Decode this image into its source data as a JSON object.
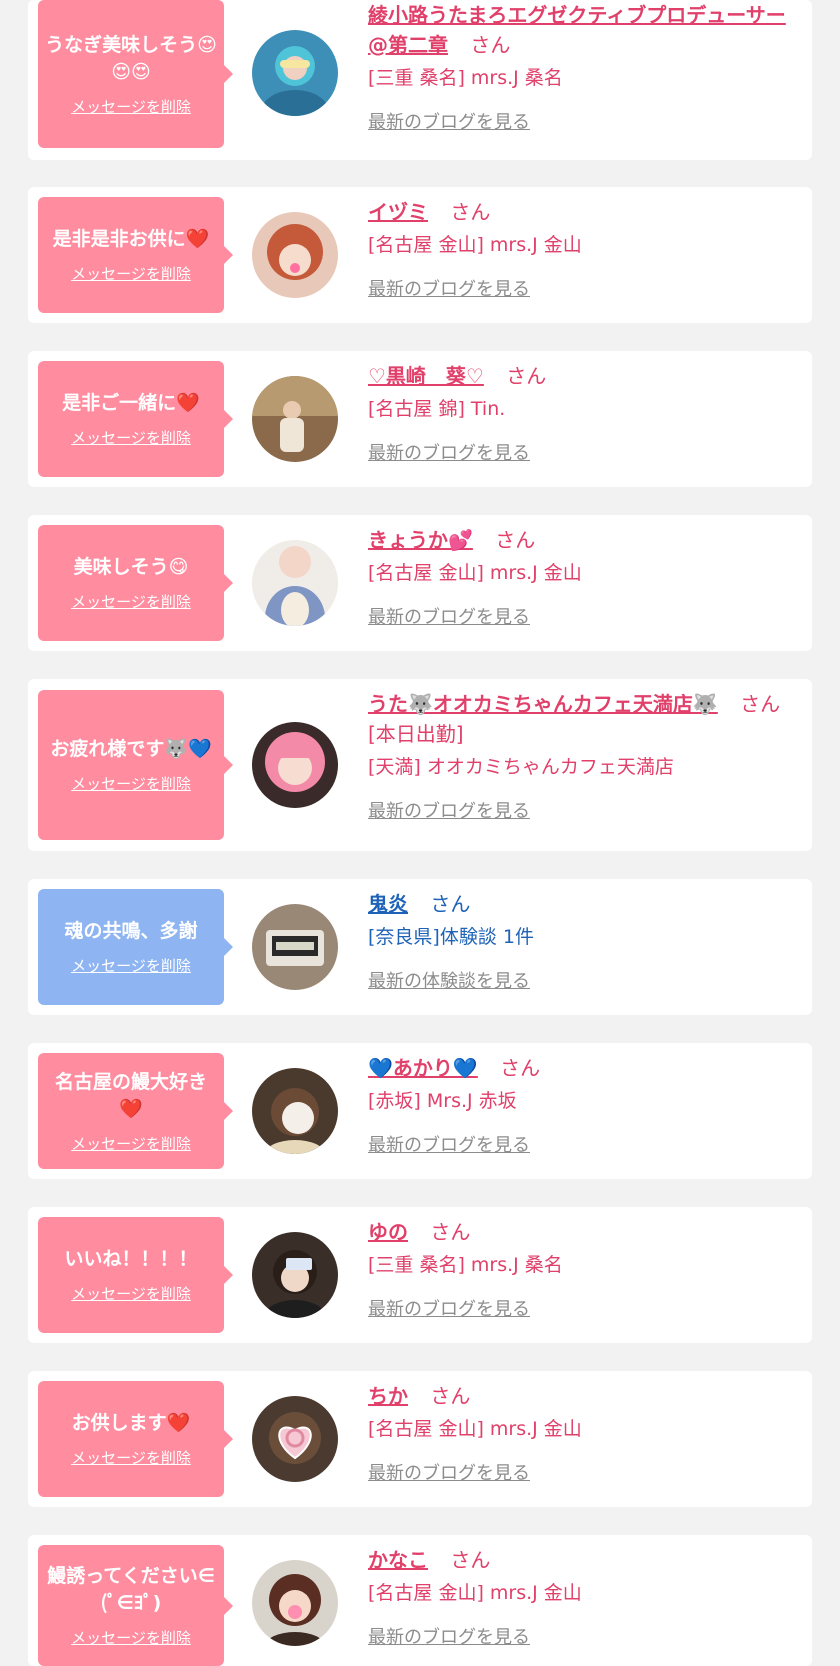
{
  "colors": {
    "pink_bubble": "#ff8c9f",
    "blue_bubble": "#8eb4f2",
    "pink_text": "#e0406a",
    "blue_text": "#1f63b8",
    "gray_link": "#8c8c8c",
    "background": "#f2f2f2"
  },
  "delete_label": "メッセージを削除",
  "san_label": "さん",
  "items": [
    {
      "message": "うなぎ美味しそう😍😍😍",
      "name": "綾小路うたまろエグゼクティブプロデューサー@第二章",
      "name_suffix": "",
      "shop": "[三重 桑名] mrs.J 桑名",
      "link": "最新のブログを見る",
      "avatar_icon": "girl-avatar-icon"
    },
    {
      "message": "是非是非お供に❤️",
      "name": "イヅミ",
      "name_suffix": "",
      "shop": "[名古屋 金山] mrs.J 金山",
      "link": "最新のブログを見る",
      "avatar_icon": "girl-avatar-icon"
    },
    {
      "message": "是非ご一緒に❤️",
      "name": "♡黒崎　葵♡",
      "name_suffix": "",
      "shop": "[名古屋 錦] Tin.",
      "link": "最新のブログを見る",
      "avatar_icon": "girl-avatar-icon"
    },
    {
      "message": "美味しそう😋",
      "name": "きょうか💕",
      "name_suffix": "",
      "shop": "[名古屋 金山] mrs.J 金山",
      "link": "最新のブログを見る",
      "avatar_icon": "girl-avatar-icon"
    },
    {
      "message": "お疲れ様です🐺💙",
      "name": "うた🐺オオカミちゃんカフェ天満店🐺",
      "name_suffix": "[本日出勤]",
      "shop": "[天満] オオカミちゃんカフェ天満店",
      "link": "最新のブログを見る",
      "avatar_icon": "girl-avatar-icon"
    },
    {
      "message": "魂の共鳴、多謝",
      "name": "鬼炎",
      "name_suffix": "",
      "shop": "[奈良県]体験談 1件",
      "link": "最新の体験談を見る",
      "avatar_icon": "clock-avatar-icon"
    },
    {
      "message": "名古屋の鰻大好き❤️",
      "name": "💙あかり💙",
      "name_suffix": "",
      "shop": "[赤坂] Mrs.J 赤坂",
      "link": "最新のブログを見る",
      "avatar_icon": "girl-avatar-icon"
    },
    {
      "message": "いいね！！！！",
      "name": "ゆの",
      "name_suffix": "",
      "shop": "[三重 桑名] mrs.J 桑名",
      "link": "最新のブログを見る",
      "avatar_icon": "girl-avatar-icon"
    },
    {
      "message": "お供します❤️",
      "name": "ちか",
      "name_suffix": "",
      "shop": "[名古屋 金山] mrs.J 金山",
      "link": "最新のブログを見る",
      "avatar_icon": "girl-avatar-icon"
    },
    {
      "message": "鰻誘ってください∈(ﾟ∈ﾖﾟ)",
      "name": "かなこ",
      "name_suffix": "",
      "shop": "[名古屋 金山] mrs.J 金山",
      "link": "最新のブログを見る",
      "avatar_icon": "girl-avatar-icon"
    }
  ]
}
